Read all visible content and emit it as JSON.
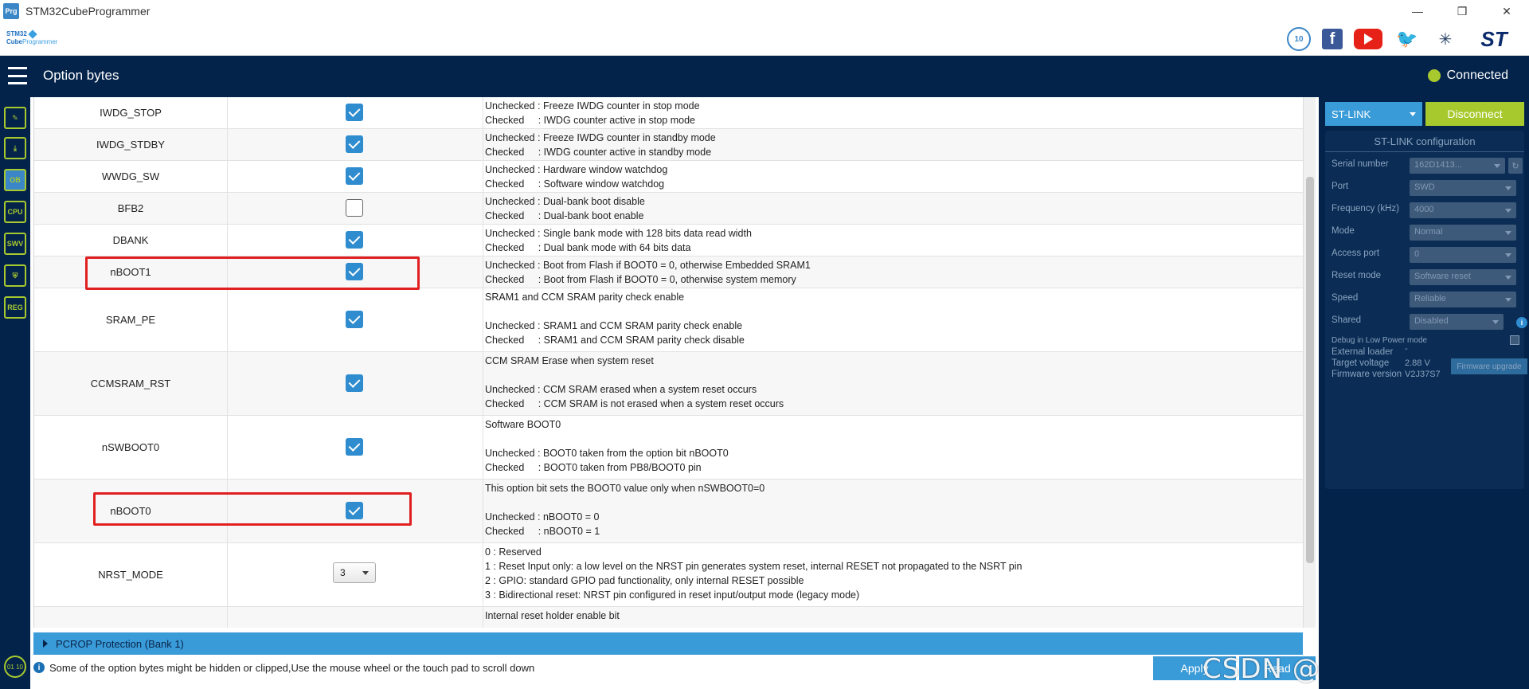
{
  "window": {
    "icon_text": "Prg",
    "title": "STM32CubeProgrammer",
    "minimize": "—",
    "maximize": "❐",
    "close": "✕"
  },
  "brand": {
    "line1": "STM32",
    "line2": "Cube",
    "line3": "Programmer"
  },
  "social": {
    "badge_text": "10",
    "facebook": "f",
    "twitter": "🐦",
    "network": "✳",
    "st_logo": "ST"
  },
  "header": {
    "title": "Option bytes",
    "connection_status": "Connected",
    "connection_color": "#a8c92e"
  },
  "nav": {
    "items": [
      "✎",
      "⤓",
      "OB",
      "CPU",
      "SWV",
      "⛨",
      "REG"
    ],
    "bottom": "01 10"
  },
  "option_bytes": [
    {
      "name": "IWDG_STOP",
      "checked": true,
      "description": "Unchecked : Freeze IWDG counter in stop mode\nChecked     : IWDG counter active in stop mode"
    },
    {
      "name": "IWDG_STDBY",
      "checked": true,
      "description": "Unchecked : Freeze IWDG counter in standby mode\nChecked     : IWDG counter active in standby mode"
    },
    {
      "name": "WWDG_SW",
      "checked": true,
      "description": "Unchecked : Hardware window watchdog\nChecked     : Software window watchdog"
    },
    {
      "name": "BFB2",
      "checked": false,
      "description": "Unchecked : Dual-bank boot disable\nChecked     : Dual-bank boot enable"
    },
    {
      "name": "DBANK",
      "checked": true,
      "description": "Unchecked : Single bank mode with 128 bits data read width\nChecked     : Dual bank mode with 64 bits data"
    },
    {
      "name": "nBOOT1",
      "checked": true,
      "description": "Unchecked : Boot from Flash if BOOT0 = 0, otherwise Embedded SRAM1\nChecked     : Boot from Flash if BOOT0 = 0, otherwise system memory"
    },
    {
      "name": "SRAM_PE",
      "checked": true,
      "description": "SRAM1 and CCM SRAM parity check enable\n\nUnchecked : SRAM1 and CCM SRAM parity check enable\nChecked     : SRAM1 and CCM SRAM parity check disable"
    },
    {
      "name": "CCMSRAM_RST",
      "checked": true,
      "description": "CCM SRAM Erase when system reset\n\nUnchecked : CCM SRAM erased when a system reset occurs\nChecked     : CCM SRAM is not erased when a system reset occurs"
    },
    {
      "name": "nSWBOOT0",
      "checked": true,
      "description": "Software BOOT0\n\nUnchecked : BOOT0 taken from the option bit nBOOT0\nChecked     : BOOT0 taken from PB8/BOOT0 pin"
    },
    {
      "name": "nBOOT0",
      "checked": true,
      "description": "This option bit sets the BOOT0 value only when nSWBOOT0=0\n\nUnchecked : nBOOT0 = 0\nChecked     : nBOOT0 = 1"
    },
    {
      "name": "NRST_MODE",
      "select_value": "3",
      "description": "0 : Reserved\n1 : Reset Input only: a low level on the NRST pin generates system reset, internal RESET not propagated to the NSRT pin\n2 : GPIO: standard GPIO pad functionality, only internal RESET possible\n3 : Bidirectional reset: NRST pin configured in reset input/output mode (legacy mode)"
    },
    {
      "name": "",
      "checked": true,
      "description": "Internal reset holder enable bit"
    }
  ],
  "pcrop_section": "PCROP Protection (Bank 1)",
  "status_message": "Some of the option bytes might be hidden or clipped,Use the mouse wheel or the touch pad to scroll down",
  "buttons": {
    "apply": "Apply",
    "read": "Read"
  },
  "watermark": "CSDN @光子物联单片机",
  "right_panel": {
    "probe": "ST-LINK",
    "disconnect": "Disconnect",
    "config_title": "ST-LINK configuration",
    "fields": [
      {
        "label": "Serial number",
        "value": "162D1413..."
      },
      {
        "label": "Port",
        "value": "SWD"
      },
      {
        "label": "Frequency (kHz)",
        "value": "4000"
      },
      {
        "label": "Mode",
        "value": "Normal"
      },
      {
        "label": "Access port",
        "value": "0"
      },
      {
        "label": "Reset mode",
        "value": "Software reset"
      },
      {
        "label": "Speed",
        "value": "Reliable"
      },
      {
        "label": "Shared",
        "value": "Disabled"
      }
    ],
    "debug_low_power": "Debug in Low Power mode",
    "external_loader_label": "External loader",
    "external_loader_value": "-",
    "target_voltage_label": "Target voltage",
    "target_voltage_value": "2.88 V",
    "firmware_version_label": "Firmware version",
    "firmware_version_value": "V2J37S7",
    "firmware_upgrade": "Firmware upgrade"
  }
}
